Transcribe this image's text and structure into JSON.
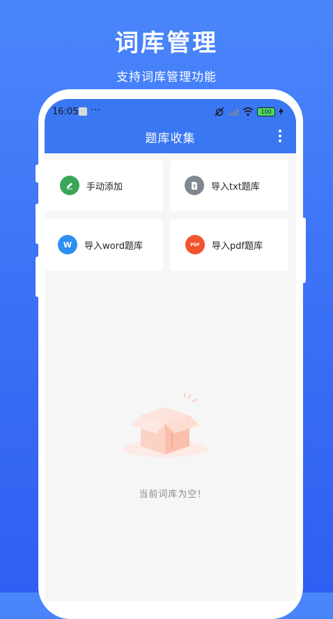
{
  "promo": {
    "title": "词库管理",
    "subtitle": "支持词库管理功能"
  },
  "status_bar": {
    "time": "16:05",
    "more": "···",
    "battery": "100"
  },
  "app_bar": {
    "title": "题库收集"
  },
  "actions": [
    {
      "label": "手动添加",
      "icon": "pencil-icon",
      "color": "#3aa65a"
    },
    {
      "label": "导入txt题库",
      "icon": "txt-file-icon",
      "color": "#7f8791"
    },
    {
      "label": "导入word题库",
      "icon": "word-icon",
      "color": "#2d8ff0",
      "glyph": "W"
    },
    {
      "label": "导入pdf题库",
      "icon": "pdf-icon",
      "color": "#f2542d",
      "glyph": "PDF"
    }
  ],
  "empty_state": {
    "message": "当前词库为空!",
    "illustration": "empty-box-icon"
  },
  "colors": {
    "background": "#3a6ff5",
    "app_bar": "#3a77f2",
    "screen": "#f6f6f6"
  }
}
